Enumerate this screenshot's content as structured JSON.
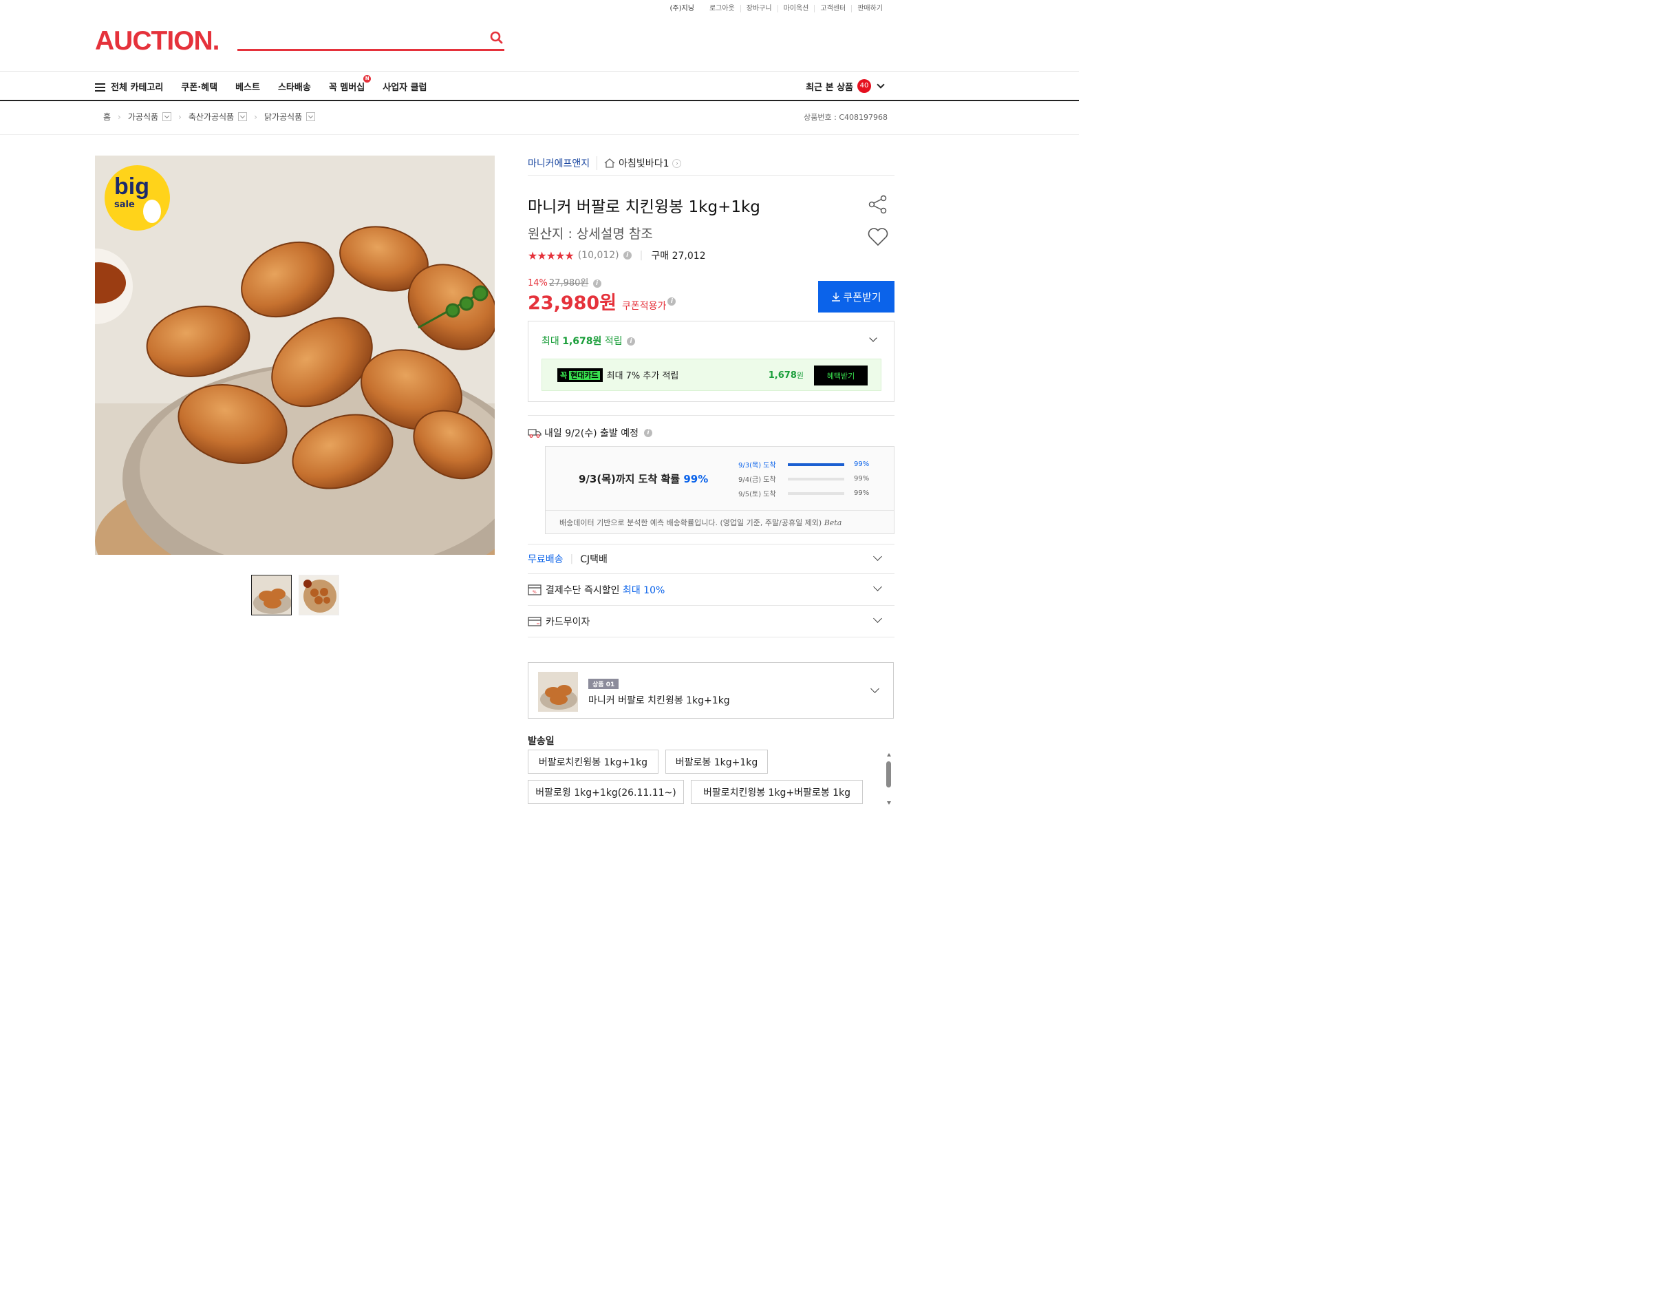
{
  "util_links": [
    "(주)지닝",
    "로그아웃",
    "장바구니",
    "마이옥션",
    "고객센터",
    "판매하기"
  ],
  "logo": "AUCTION.",
  "nav": {
    "all_category": "전체 카테고리",
    "items": [
      "쿠폰·혜택",
      "베스트",
      "스타배송",
      "꼭 멤버십",
      "사업자 클럽"
    ],
    "new_badge": "N",
    "recent_label": "최근 본 상품",
    "recent_count": "40"
  },
  "breadcrumb": [
    "홈",
    "가공식품",
    "축산가공식품",
    "닭가공식품"
  ],
  "product_no": "상품번호 : C408197968",
  "big_sale": {
    "big": "big",
    "sale": "sale"
  },
  "seller": {
    "brand": "마니커에프앤지",
    "shop": "아침빛바다1"
  },
  "title": "마니커 버팔로 치킨윙봉 1kg+1kg",
  "origin": "원산지 : 상세설명 참조",
  "rating": {
    "stars": 4.5,
    "count": "(10,012)",
    "purchase": "구매 27,012"
  },
  "price": {
    "discount_rate": "14%",
    "original": "27,980원",
    "current": "23,980원",
    "coupon_label": "쿠폰적용가",
    "coupon_button": "쿠폰받기"
  },
  "points": {
    "prefix": "최대",
    "amount": "1,678원",
    "suffix": "적립",
    "card_tag_a": "꼭",
    "card_tag_b": "현대카드",
    "card_desc": "최대 7% 추가 적립",
    "card_amount": "1,678",
    "card_amount_unit": "원",
    "card_button": "혜택받기"
  },
  "shipping": {
    "departure": "내일 9/2(수) 출발 예정",
    "prob_prefix": "9/3(목)까지 도착 확률",
    "prob_value": "99%",
    "rows": [
      {
        "label": "9/3(목) 도착",
        "pct": "99%",
        "fill": 1.0
      },
      {
        "label": "9/4(금) 도착",
        "pct": "99%",
        "fill": 0.0
      },
      {
        "label": "9/5(토) 도착",
        "pct": "99%",
        "fill": 0.0
      }
    ],
    "note": "배송데이터 기반으로 분석한 예측 배송확률입니다. (영업일 기준, 주말/공휴일 제외)",
    "beta": "Beta"
  },
  "accordions": {
    "free_shipping": "무료배송",
    "courier": "CJ택배",
    "pay_discount": "결제수단 즉시할인",
    "pay_discount_max": "최대 10%",
    "installment": "카드무이자"
  },
  "option": {
    "badge": "상품 01",
    "name": "마니커 버팔로 치킨윙봉 1kg+1kg"
  },
  "ship_date_label": "발송일",
  "chips": [
    "버팔로치킨윙봉 1kg+1kg",
    "버팔로봉 1kg+1kg",
    "버팔로윙 1kg+1kg(26.11.11~)",
    "버팔로치킨윙봉 1kg+버팔로봉 1kg"
  ],
  "colors": {
    "brand_red": "#e5323b",
    "blue": "#0b63ea",
    "green": "#1a9e3a",
    "hyundai_green": "#39e24f"
  }
}
